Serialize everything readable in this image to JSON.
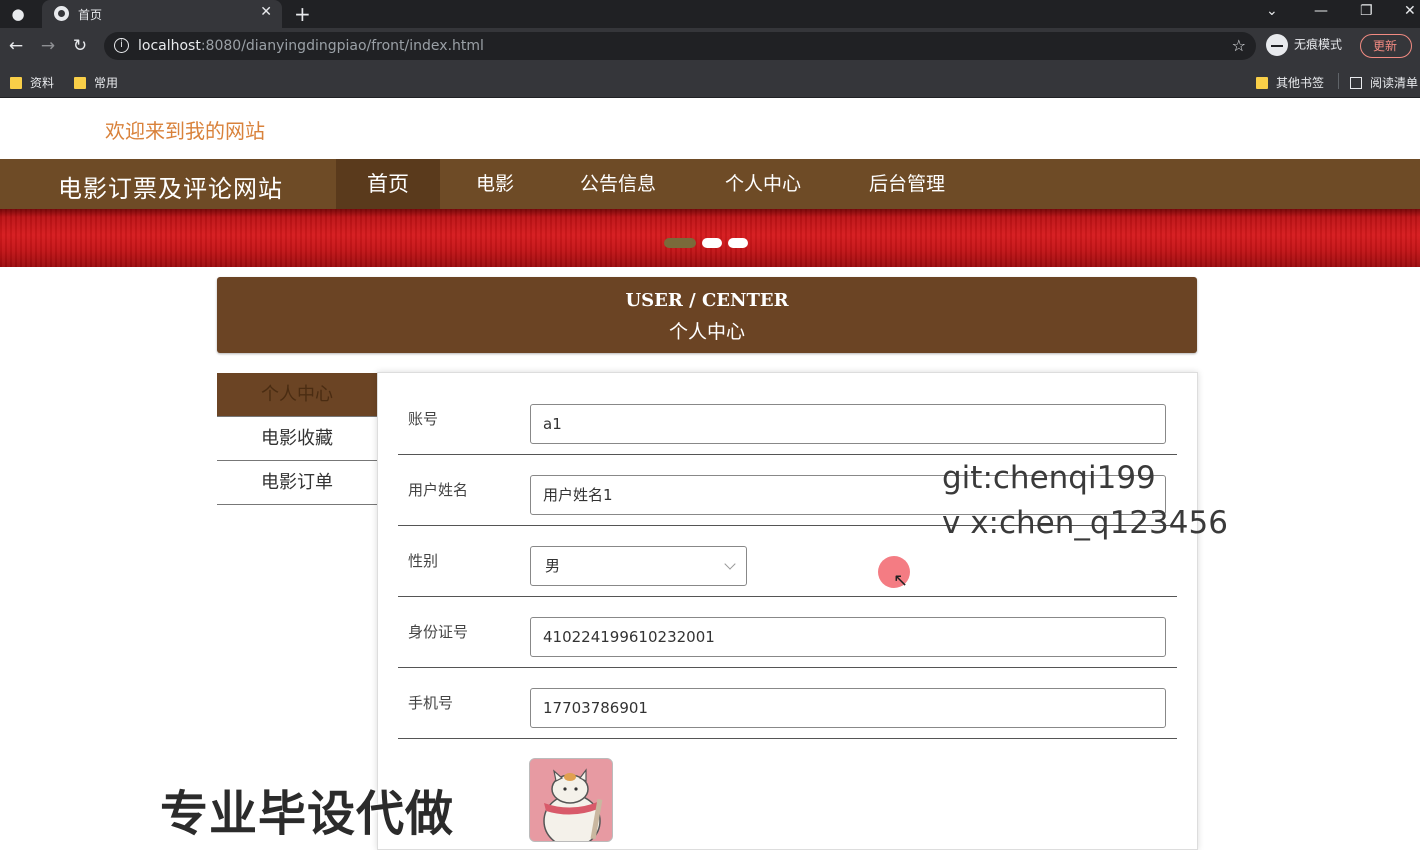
{
  "browser": {
    "tab_title": "首页",
    "url_host": "localhost",
    "url_rest": ":8080/dianyingdingpiao/front/index.html",
    "incognito_label": "无痕模式",
    "update_label": "更新",
    "bookmarks": [
      "资料",
      "常用"
    ],
    "bookmarks_right": [
      "其他书签",
      "阅读清单"
    ]
  },
  "site": {
    "welcome": "欢迎来到我的网站",
    "title": "电影订票及评论网站",
    "nav": [
      "首页",
      "电影",
      "公告信息",
      "个人中心",
      "后台管理"
    ],
    "active_nav": "首页",
    "banner_dots": 3,
    "banner_active_dot": 0,
    "colors": {
      "nav_bg": "#6e4b26",
      "accent": "#d9823b",
      "banner": "#d61a1d"
    }
  },
  "user_center": {
    "title_en": "USER / CENTER",
    "title_zh": "个人中心",
    "menu": [
      "个人中心",
      "电影收藏",
      "电影订单"
    ],
    "active_menu": "个人中心"
  },
  "form": {
    "account_label": "账号",
    "account_value": "a1",
    "name_label": "用户姓名",
    "name_value": "用户姓名1",
    "gender_label": "性别",
    "gender_value": "男",
    "id_label": "身份证号",
    "id_value": "410224199610232001",
    "phone_label": "手机号",
    "phone_value": "17703786901"
  },
  "overlay": {
    "watermark_git": "git:chenqi199",
    "watermark_wx": "v x:chen_q123456",
    "watermark_promo": "专业毕设代做"
  }
}
